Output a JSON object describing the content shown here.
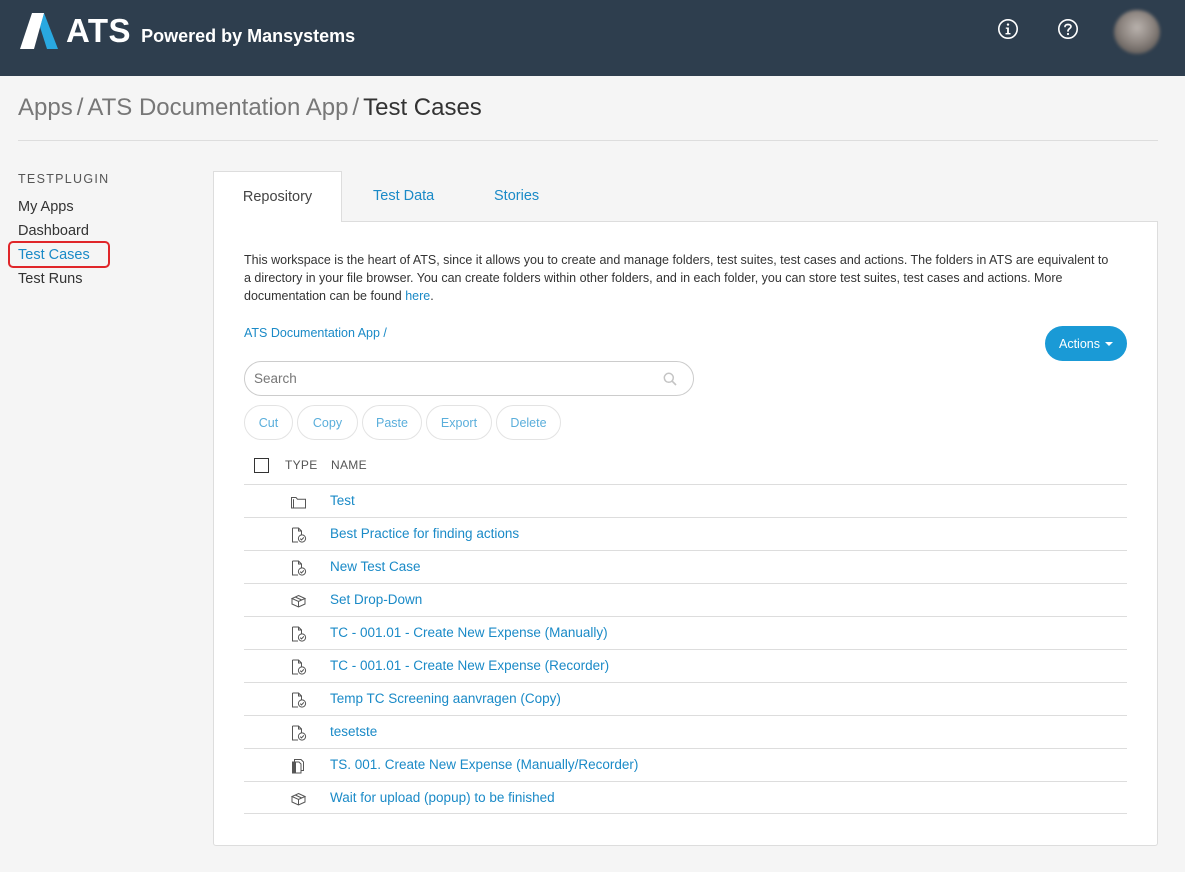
{
  "header": {
    "logo_text": "ATS",
    "logo_tagline": "Powered by Mansystems",
    "icons": [
      "info-icon",
      "help-icon",
      "avatar"
    ]
  },
  "breadcrumb": {
    "items": [
      "Apps",
      "ATS Documentation App",
      "Test Cases"
    ],
    "separator": "/"
  },
  "sidebar": {
    "heading": "TESTPLUGIN",
    "items": [
      {
        "label": "My Apps"
      },
      {
        "label": "Dashboard"
      },
      {
        "label": "Test Cases",
        "active": true
      },
      {
        "label": "Test Runs"
      }
    ]
  },
  "tabs": [
    {
      "label": "Repository",
      "active": true
    },
    {
      "label": "Test Data"
    },
    {
      "label": "Stories"
    }
  ],
  "repository": {
    "description": "This workspace is the heart of ATS, since it allows you to create and manage folders, test suites, test cases and actions. The folders in ATS are equivalent to a directory in your file browser. You can create folders within other folders, and in each folder, you can store test suites, test cases and actions. More documentation can be found ",
    "doc_link": "here",
    "doc_link_suffix": ".",
    "path": "ATS Documentation App /",
    "actions_label": "Actions",
    "search_placeholder": "Search",
    "toolbar": {
      "cut": "Cut",
      "copy": "Copy",
      "paste": "Paste",
      "export": "Export",
      "delete": "Delete"
    },
    "columns": {
      "type": "TYPE",
      "name": "NAME"
    },
    "rows": [
      {
        "type": "folder-icon",
        "name": "Test"
      },
      {
        "type": "test-case-icon",
        "name": "Best Practice for finding actions"
      },
      {
        "type": "test-case-icon",
        "name": "New Test Case"
      },
      {
        "type": "action-icon",
        "name": "Set Drop-Down"
      },
      {
        "type": "test-case-icon",
        "name": "TC - 001.01 - Create New Expense (Manually)"
      },
      {
        "type": "test-case-icon",
        "name": "TC - 001.01 - Create New Expense (Recorder)"
      },
      {
        "type": "test-case-icon",
        "name": "Temp TC Screening aanvragen (Copy)"
      },
      {
        "type": "test-case-icon",
        "name": "tesetste"
      },
      {
        "type": "test-suite-icon",
        "name": "TS. 001. Create New Expense (Manually/Recorder)"
      },
      {
        "type": "action-icon",
        "name": "Wait for upload (popup) to be finished"
      }
    ]
  },
  "colors": {
    "header_bg": "#2e3e4e",
    "link": "#1a8ac7",
    "primary_button": "#1a9ad6",
    "highlight_border": "#e0262a",
    "logo_accent": "#29a8e0"
  }
}
